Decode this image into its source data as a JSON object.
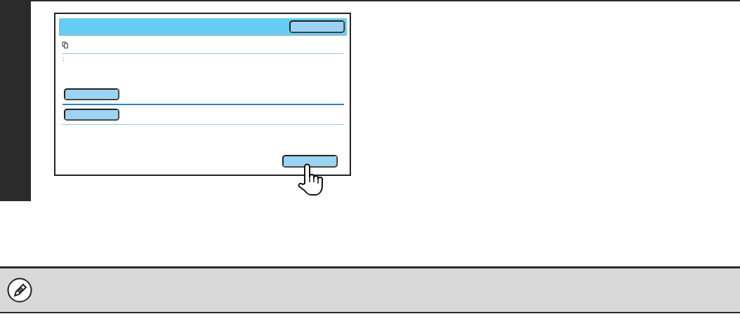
{
  "screen": {
    "info_text": ":",
    "buttons": [
      {
        "kind": "title",
        "pressed": false
      },
      {
        "kind": "option",
        "pressed": false
      },
      {
        "kind": "option",
        "pressed": false
      },
      {
        "kind": "confirm",
        "pressed": true
      }
    ]
  }
}
